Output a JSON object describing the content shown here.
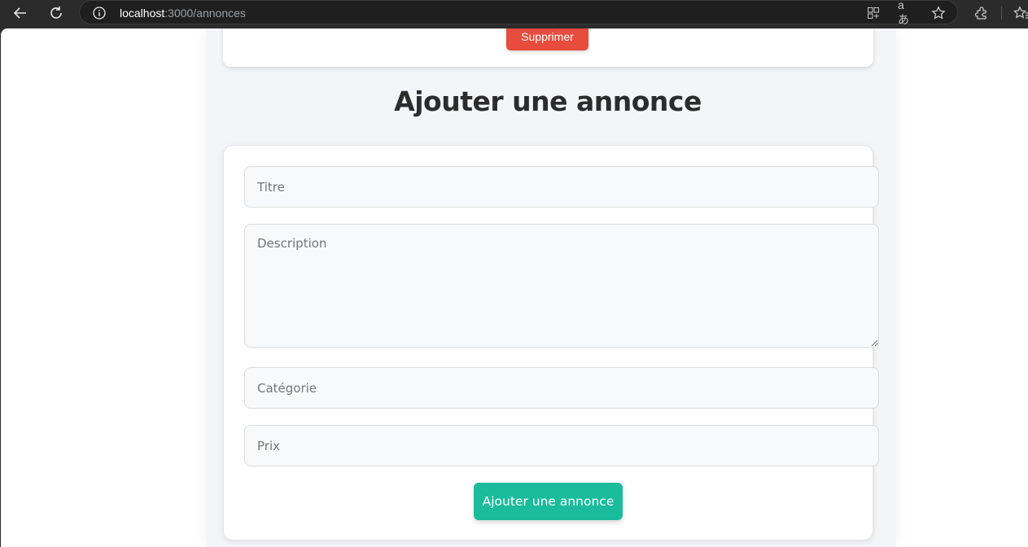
{
  "browser": {
    "url_host": "localhost",
    "url_path": ":3000/annonces",
    "icons": [
      "back-arrow-icon",
      "reload-icon",
      "info-icon",
      "app-grid-icon",
      "translate-icon",
      "star-icon",
      "extensions-icon",
      "favorites-icon"
    ],
    "translate_glyph": "aあ"
  },
  "previous_card": {
    "delete_label": "Supprimer"
  },
  "form": {
    "heading": "Ajouter une annonce",
    "title_placeholder": "Titre",
    "description_placeholder": "Description",
    "category_placeholder": "Catégorie",
    "price_placeholder": "Prix",
    "submit_label": "Ajouter une annonce"
  },
  "colors": {
    "delete": "#e74c3c",
    "submit": "#1abc9c",
    "heading": "#2c2c2c"
  }
}
